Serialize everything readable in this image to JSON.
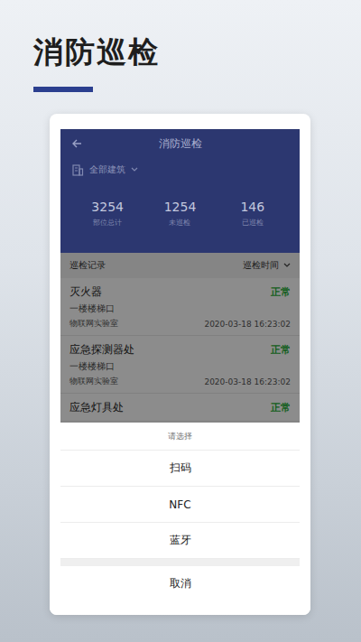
{
  "page": {
    "title": "消防巡检"
  },
  "app": {
    "title": "消防巡检",
    "building": "全部建筑"
  },
  "stats": [
    {
      "value": "3254",
      "label": "部位总计"
    },
    {
      "value": "1254",
      "label": "未巡检"
    },
    {
      "value": "146",
      "label": "已巡检"
    }
  ],
  "records": {
    "title": "巡检记录",
    "sort": "巡检时间"
  },
  "items": [
    {
      "name": "灭火器",
      "location": "一楼楼梯口",
      "place": "物联网实验室",
      "time": "2020-03-18 16:23:02",
      "status": "正常"
    },
    {
      "name": "应急探测器处",
      "location": "一楼楼梯口",
      "place": "物联网实验室",
      "time": "2020-03-18 16:23:02",
      "status": "正常"
    },
    {
      "name": "应急灯具处",
      "location": "",
      "place": "",
      "time": "",
      "status": "正常"
    }
  ],
  "sheet": {
    "title": "请选择",
    "options": [
      "扫码",
      "NFC",
      "蓝牙"
    ],
    "cancel": "取消"
  }
}
